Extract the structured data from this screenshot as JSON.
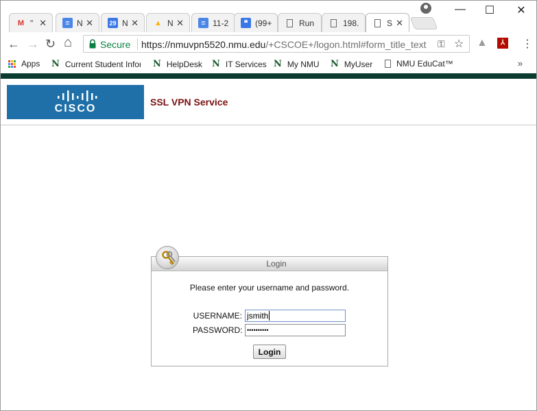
{
  "browser": {
    "tabs": [
      {
        "title": "\"",
        "icon": "gmail-icon",
        "icon_glyph": "M",
        "icon_color": "#d93025"
      },
      {
        "title": "N",
        "icon": "docs-icon",
        "icon_glyph": "≡",
        "icon_color": "#4a86e8"
      },
      {
        "title": "N",
        "icon": "calendar-icon",
        "icon_glyph": "29",
        "icon_color": "#3b78e7"
      },
      {
        "title": "N",
        "icon": "drive-icon",
        "icon_glyph": "▲",
        "icon_color": "#f4b400"
      },
      {
        "title": "11-2",
        "icon": "docs-icon",
        "icon_glyph": "≡",
        "icon_color": "#4a86e8"
      },
      {
        "title": "(99+",
        "icon": "chat-icon",
        "icon_glyph": "❝",
        "icon_color": "#3b78e7"
      },
      {
        "title": "Run",
        "icon": "page-icon",
        "icon_glyph": "",
        "icon_color": "#666666"
      },
      {
        "title": "198.",
        "icon": "page-icon",
        "icon_glyph": "",
        "icon_color": "#666666"
      },
      {
        "title": "S",
        "icon": "page-icon",
        "icon_glyph": "",
        "icon_color": "#666666",
        "active": true
      }
    ],
    "close_glyph": "✕",
    "window_controls": {
      "minimize": "—",
      "maximize": "☐",
      "close": "✕"
    },
    "profile_icon": "account-icon",
    "toolbar": {
      "back": "←",
      "forward": "→",
      "reload": "↻",
      "home": "⌂",
      "secure_label": "Secure",
      "url_host": "https://nmuvpn5520.nmu.edu",
      "url_path": "/+CSCOE+/logon.html#form_title_text",
      "menu_glyph": "⋮"
    },
    "bookmarks": [
      {
        "label": "Apps",
        "icon": "apps-icon"
      },
      {
        "label": "Current Student Infor",
        "icon": "nmu-icon"
      },
      {
        "label": "HelpDesk",
        "icon": "nmu-icon"
      },
      {
        "label": "IT Services",
        "icon": "nmu-icon"
      },
      {
        "label": "My NMU",
        "icon": "nmu-icon"
      },
      {
        "label": "MyUser",
        "icon": "nmu-icon"
      },
      {
        "label": "NMU EduCat™",
        "icon": "page-icon"
      }
    ],
    "bookmarks_more": "»"
  },
  "page": {
    "logo_text": "CISCO",
    "service_title": "SSL VPN Service",
    "login": {
      "title": "Login",
      "prompt": "Please enter your username and password.",
      "username_label": "USERNAME:",
      "username_value": "jsmith",
      "password_label": "PASSWORD:",
      "password_value": "••••••••••",
      "button_label": "Login"
    }
  },
  "colors": {
    "brand_blue": "#1f6fa8",
    "title_red": "#7a1010",
    "secure_green": "#0b8043",
    "nmu_green": "#0b3b2e"
  }
}
